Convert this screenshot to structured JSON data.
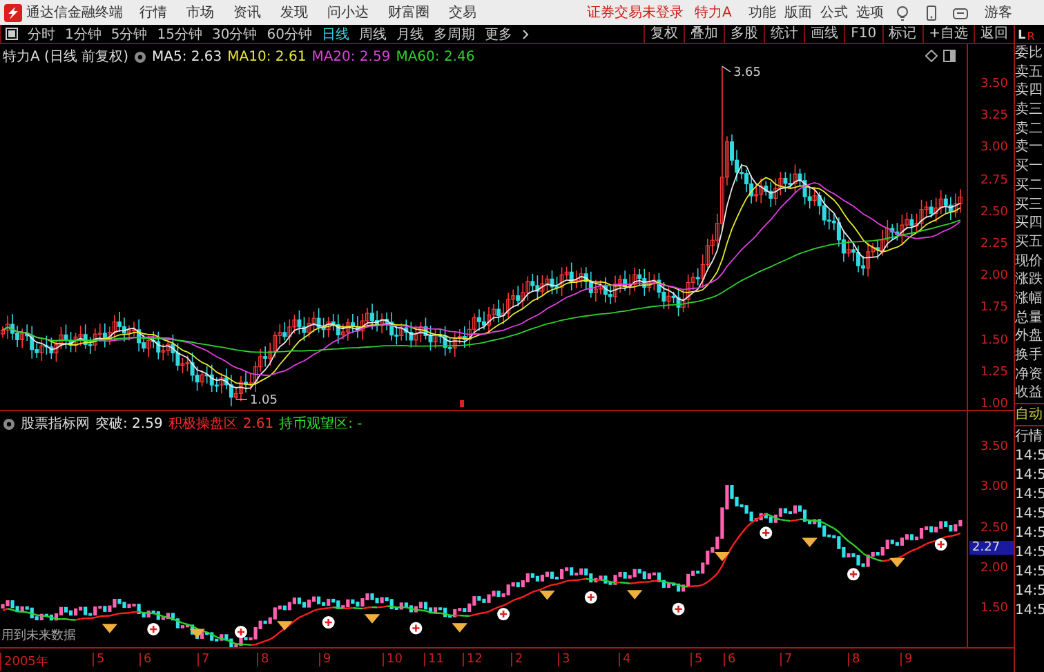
{
  "app": {
    "title": "通达信金融终端"
  },
  "menu": [
    "行情",
    "市场",
    "资讯",
    "发现",
    "问小达",
    "财富圈",
    "交易"
  ],
  "login_status": "证券交易未登录",
  "stock_name": "特力A",
  "top_actions": [
    "功能",
    "版面",
    "公式",
    "选项"
  ],
  "user": "游客",
  "periods": [
    {
      "label": "分时",
      "selected": false
    },
    {
      "label": "1分钟",
      "selected": false
    },
    {
      "label": "5分钟",
      "selected": false
    },
    {
      "label": "15分钟",
      "selected": false
    },
    {
      "label": "30分钟",
      "selected": false
    },
    {
      "label": "60分钟",
      "selected": false
    },
    {
      "label": "日线",
      "selected": true
    },
    {
      "label": "周线",
      "selected": false
    },
    {
      "label": "月线",
      "selected": false
    },
    {
      "label": "多周期",
      "selected": false
    },
    {
      "label": "更多",
      "selected": false
    }
  ],
  "tools": [
    "复权",
    "叠加",
    "多股",
    "统计",
    "画线",
    "F10",
    "标记",
    "+自选",
    "返回"
  ],
  "side_badge": {
    "left": "L",
    "right": "R"
  },
  "main_chart": {
    "title": "特力A (日线 前复权)",
    "indicators": [
      {
        "label": "MA5: 2.63",
        "color": "#e8e8e8"
      },
      {
        "label": "MA10: 2.61",
        "color": "#e8e830"
      },
      {
        "label": "MA20: 2.59",
        "color": "#e040e0"
      },
      {
        "label": "MA60: 2.46",
        "color": "#30d030"
      }
    ],
    "high_label": "3.65",
    "low_label": "1.05",
    "y_axis": [
      "3.50",
      "3.25",
      "3.00",
      "2.75",
      "2.50",
      "2.25",
      "2.00",
      "1.75",
      "1.50",
      "1.25",
      "1.00"
    ]
  },
  "indicator_chart": {
    "source": "股票指标网",
    "items": [
      {
        "label": "突破: 2.59",
        "color": "#e8e8e8"
      },
      {
        "label": "积极操盘区",
        "color": "#ff2a2a"
      },
      {
        "label": "2.61",
        "color": "#ff2a2a"
      },
      {
        "label": "持币观望区: -",
        "color": "#30e030"
      }
    ],
    "current_value": "2.27",
    "y_axis": [
      "3.50",
      "3.00",
      "2.50",
      "2.00",
      "1.50"
    ],
    "note": "用到未来数据"
  },
  "x_axis": [
    "2005年",
    "5",
    "6",
    "7",
    "8",
    "9",
    "10",
    "11",
    "12",
    "2",
    "3",
    "4",
    "5",
    "6",
    "7",
    "8",
    "9"
  ],
  "quote_panel": {
    "fields": [
      "委比",
      "卖五",
      "卖四",
      "卖三",
      "卖二",
      "卖一",
      "买一",
      "买二",
      "买三",
      "买四",
      "买五",
      "现价",
      "涨跌",
      "涨幅",
      "总量",
      "外盘",
      "换手",
      "净资",
      "收益"
    ],
    "sections": [
      "自动",
      "行情"
    ],
    "times": [
      "14:5",
      "14:5",
      "14:5",
      "14:5",
      "14:5",
      "14:5",
      "14:5",
      "14:5",
      "14:5"
    ]
  }
}
